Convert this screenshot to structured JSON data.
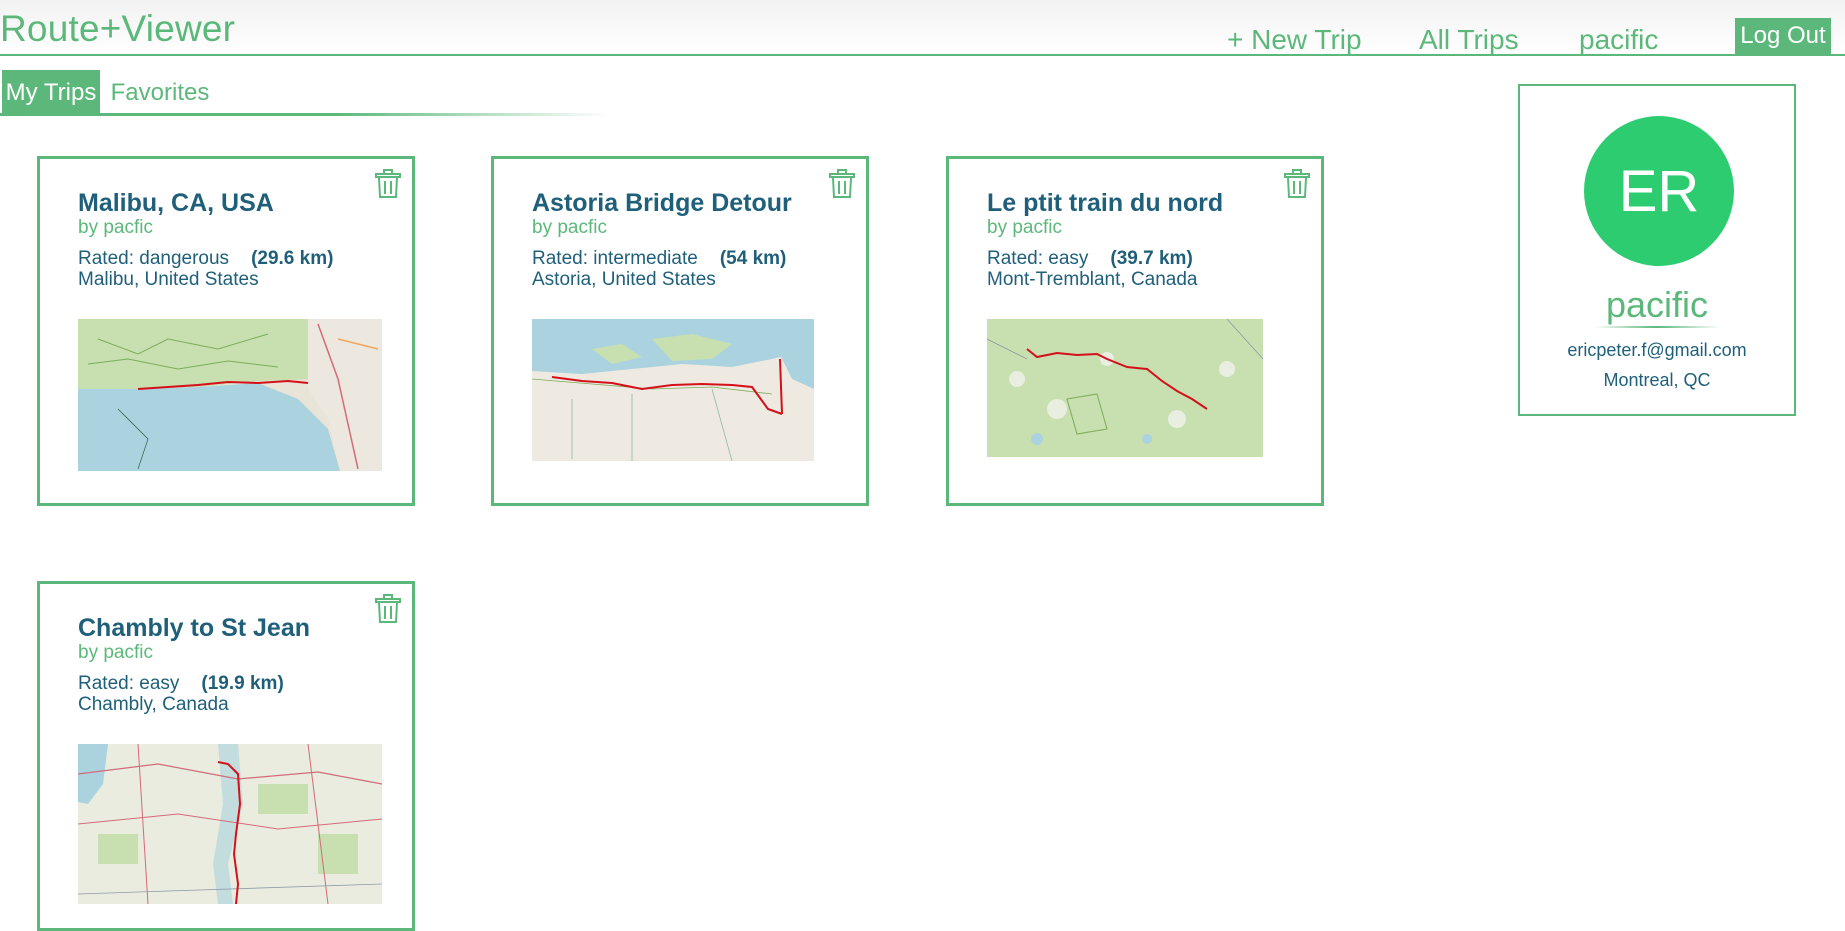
{
  "app": {
    "brand": "Route+Viewer"
  },
  "nav": {
    "new_trip": "+ New Trip",
    "all_trips": "All Trips",
    "user": "pacific",
    "logout": "Log Out"
  },
  "tabs": [
    {
      "label": "My Trips",
      "active": true
    },
    {
      "label": "Favorites",
      "active": false
    }
  ],
  "trips": [
    {
      "title": "Malibu, CA, USA",
      "byline": "by pacfic",
      "rating": "Rated: dangerous",
      "distance": "(29.6 km)",
      "location": "Malibu, United States",
      "map_icon": "coastal-route-map"
    },
    {
      "title": "Astoria Bridge Detour",
      "byline": "by pacfic",
      "rating": "Rated: intermediate",
      "distance": "(54 km)",
      "location": "Astoria, United States",
      "map_icon": "river-route-map"
    },
    {
      "title": "Le ptit train du nord",
      "byline": "by pacfic",
      "rating": "Rated: easy",
      "distance": "(39.7 km)",
      "location": "Mont-Tremblant, Canada",
      "map_icon": "forest-route-map"
    },
    {
      "title": "Chambly to St Jean",
      "byline": "by pacfic",
      "rating": "Rated: easy",
      "distance": "(19.9 km)",
      "location": "Chambly, Canada",
      "map_icon": "town-route-map"
    }
  ],
  "profile": {
    "initials": "ER",
    "username": "pacific",
    "email": "ericpeter.f@gmail.com",
    "city": "Montreal, QC"
  },
  "colors": {
    "accent": "#5cb87a",
    "text": "#1f5f7a",
    "avatar": "#2ecc71",
    "route": "#d4101a",
    "water": "#aad3df",
    "forest": "#c8dfb0"
  }
}
